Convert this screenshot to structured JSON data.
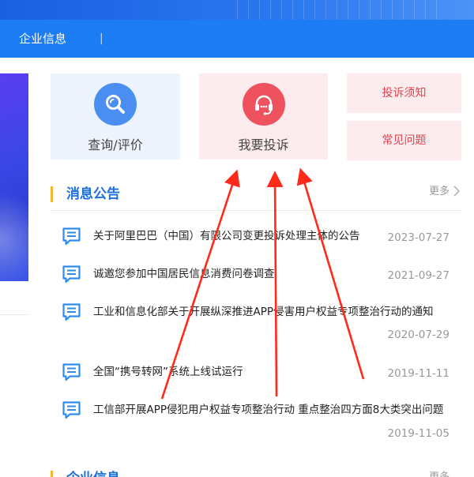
{
  "nav": {
    "item": "企业信息",
    "separator": "|"
  },
  "cards": {
    "query": {
      "label": "查询/评价",
      "icon": "search-icon"
    },
    "complain": {
      "label": "我要投诉",
      "icon": "headset-icon"
    },
    "notice": {
      "label": "投诉须知"
    },
    "faq": {
      "label": "常见问题"
    }
  },
  "announcements": {
    "title": "消息公告",
    "more": "更多",
    "items": [
      {
        "title": "关于阿里巴巴（中国）有限公司变更投诉处理主体的公告",
        "date": "2023-07-27"
      },
      {
        "title": "诚邀您参加中国居民信息消费问卷调查",
        "date": "2021-09-27"
      },
      {
        "title": "工业和信息化部关于开展纵深推进APP侵害用户权益专项整治行动的通知",
        "date": "2020-07-29"
      },
      {
        "title": "全国“携号转网”系统上线试运行",
        "date": "2019-11-11"
      },
      {
        "title": "工信部开展APP侵犯用户权益专项整治行动 重点整治四方面8大类突出问题",
        "date": "2019-11-05"
      }
    ]
  },
  "next_section": {
    "title": "企业信息",
    "more": "更多"
  },
  "colors": {
    "nav": "#1c7cf3",
    "accent_blue": "#1d6fe0",
    "accent_red": "#ee525f",
    "arrow": "#ff2a1a",
    "title_bar": "#f2b630"
  }
}
